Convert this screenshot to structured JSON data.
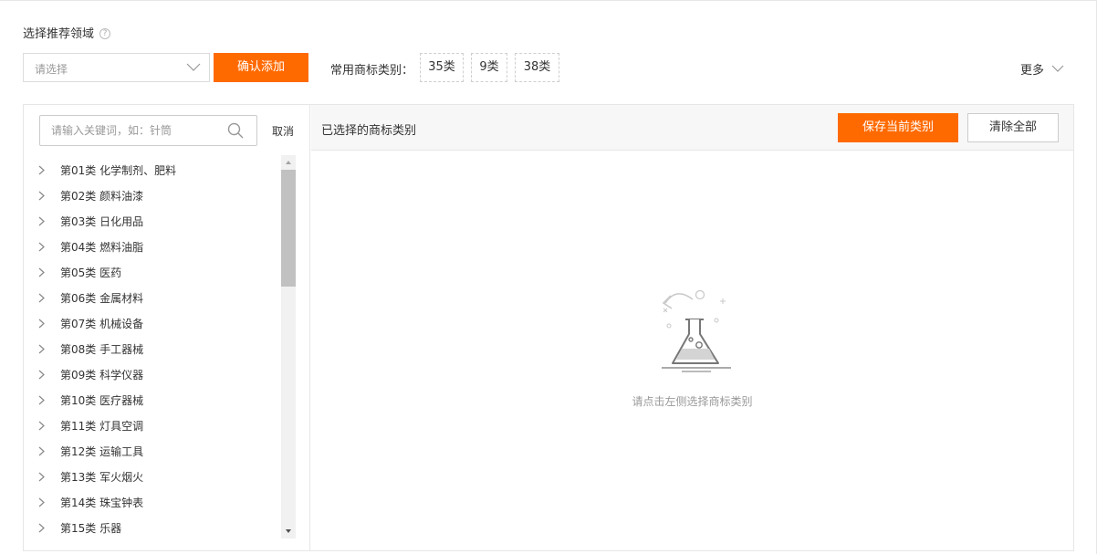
{
  "header": {
    "title": "选择推荐领域",
    "help_icon": "?"
  },
  "domain_select": {
    "placeholder": "请选择"
  },
  "confirm_button": "确认添加",
  "common": {
    "label": "常用商标类别：",
    "tags": [
      "35类",
      "9类",
      "38类"
    ]
  },
  "more": "更多",
  "search": {
    "placeholder": "请输入关键词，如：针筒",
    "cancel": "取消"
  },
  "categories": [
    "第01类 化学制剂、肥料",
    "第02类 颜料油漆",
    "第03类 日化用品",
    "第04类 燃料油脂",
    "第05类 医药",
    "第06类 金属材料",
    "第07类 机械设备",
    "第08类 手工器械",
    "第09类 科学仪器",
    "第10类 医疗器械",
    "第11类 灯具空调",
    "第12类 运输工具",
    "第13类 军火烟火",
    "第14类 珠宝钟表",
    "第15类 乐器"
  ],
  "selected": {
    "title": "已选择的商标类别",
    "save_button": "保存当前类别",
    "clear_button": "清除全部",
    "empty_text": "请点击左侧选择商标类别"
  },
  "colors": {
    "accent": "#ff6a00",
    "border": "#e6e6e6",
    "header_bg": "#f7f7f7"
  }
}
